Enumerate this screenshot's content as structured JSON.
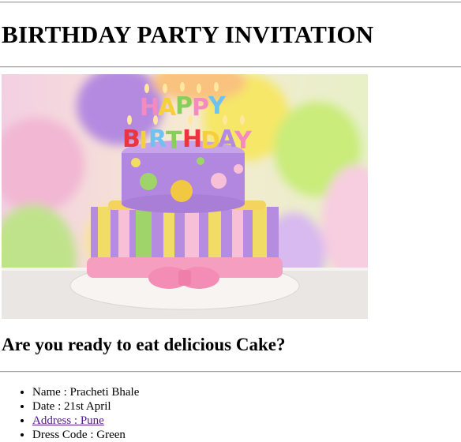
{
  "page": {
    "title": "BIRTHDAY PARTY INVITATION",
    "image_alt": "HAPPY BIRTHDAY",
    "question": "Are you ready to eat delicious Cake?",
    "details": [
      {
        "text": "Name : Pracheti Bhale"
      },
      {
        "text": "Date : 21st April"
      },
      {
        "text": "Address : Pune"
      },
      {
        "text": "Dress Code : Green"
      }
    ]
  },
  "colors": {
    "link_visited": "#551a8b",
    "rule": "#a0a0a0"
  }
}
